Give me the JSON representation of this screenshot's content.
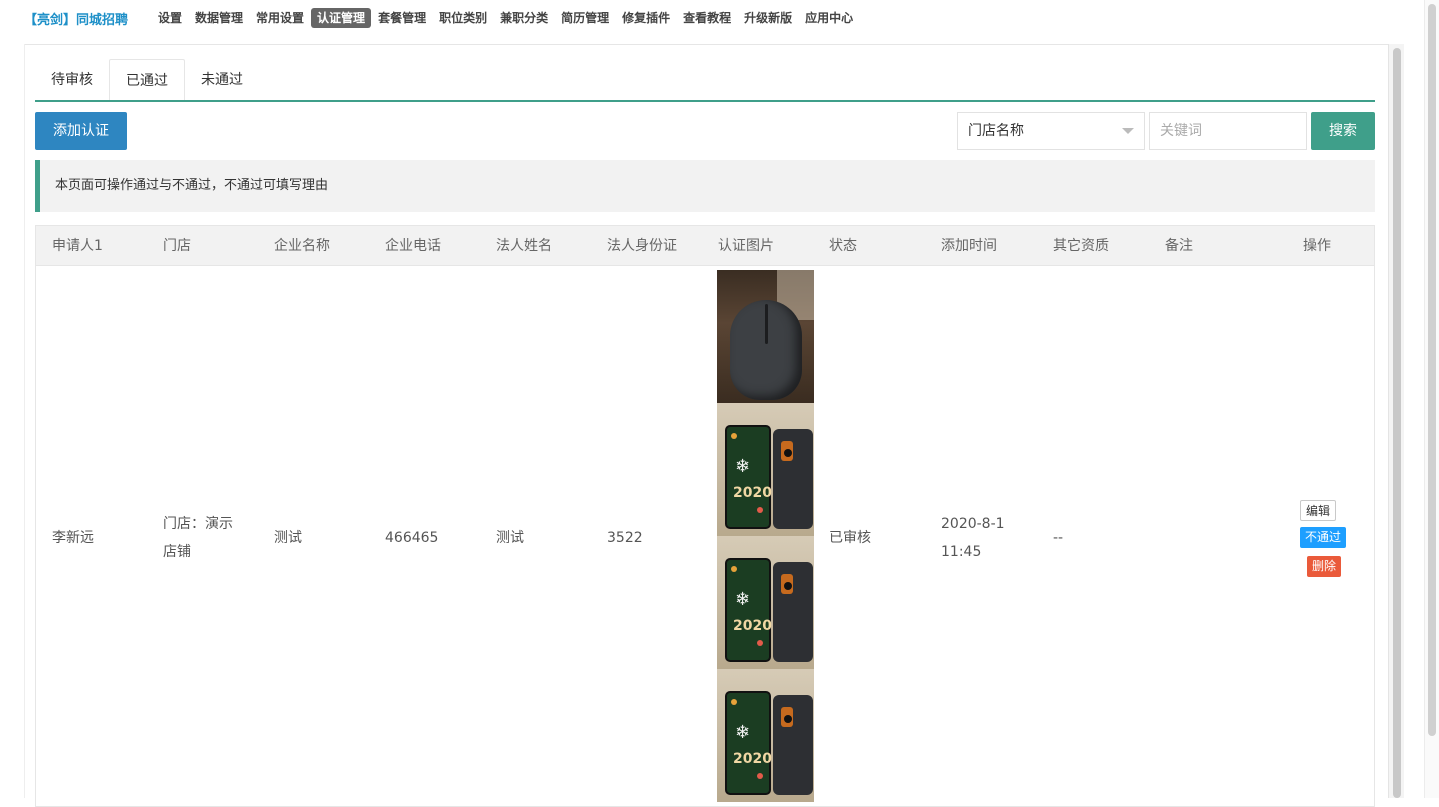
{
  "app": {
    "brand": "【亮剑】同城招聘"
  },
  "nav": {
    "items": [
      {
        "label": "设置"
      },
      {
        "label": "数据管理"
      },
      {
        "label": "常用设置"
      },
      {
        "label": "认证管理",
        "active": true
      },
      {
        "label": "套餐管理"
      },
      {
        "label": "职位类别"
      },
      {
        "label": "兼职分类"
      },
      {
        "label": "简历管理"
      },
      {
        "label": "修复插件"
      },
      {
        "label": "查看教程"
      },
      {
        "label": "升级新版"
      },
      {
        "label": "应用中心"
      }
    ]
  },
  "tabs": [
    {
      "label": "待审核"
    },
    {
      "label": "已通过",
      "active": true
    },
    {
      "label": "未通过"
    }
  ],
  "toolbar": {
    "add_label": "添加认证",
    "select_value": "门店名称",
    "keyword_placeholder": "关键词",
    "search_label": "搜索"
  },
  "notice": "本页面可操作通过与不通过，不通过可填写理由",
  "table": {
    "headers": [
      "申请人1",
      "门店",
      "企业名称",
      "企业电话",
      "法人姓名",
      "法人身份证",
      "认证图片",
      "状态",
      "添加时间",
      "其它资质",
      "备注",
      "操作"
    ],
    "rows": [
      {
        "applicant": "李新远",
        "store_line1": "门店：演示",
        "store_line2": "店铺",
        "company": "测试",
        "phone": "466465",
        "legal_name": "测试",
        "legal_id": "3522",
        "status": "已审核",
        "time_line1": "2020-8-1",
        "time_line2": "11:45",
        "other": "--",
        "remark": "",
        "actions": {
          "edit": "编辑",
          "reject": "不通过",
          "delete": "删除"
        }
      }
    ]
  },
  "colors": {
    "accent": "#3f9f8a",
    "primary": "#2e86c1",
    "danger": "#ea5a3a",
    "info": "#1e9fff",
    "brand": "#1e90c8"
  }
}
